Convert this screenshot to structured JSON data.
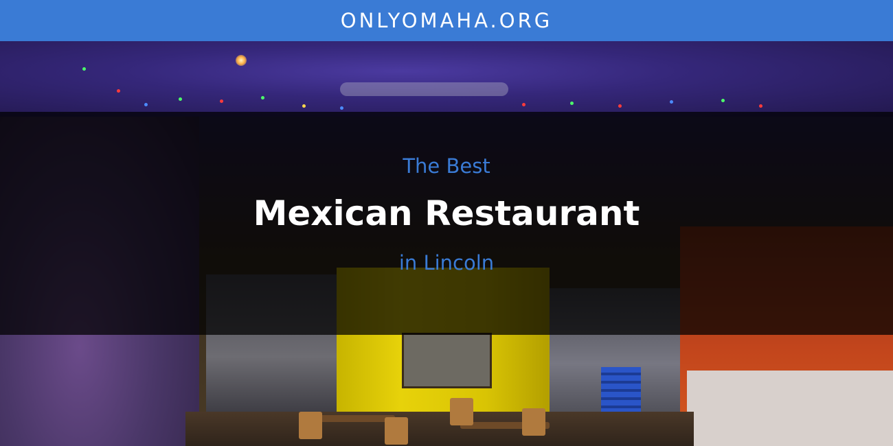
{
  "header": {
    "site_name": "ONLYOMAHA.ORG",
    "background_color": "#3a7bd5"
  },
  "headline": {
    "line1": "The Best",
    "line2": "Mexican Restaurant",
    "line3": "in Lincoln",
    "accent_color": "#3a7bd5",
    "main_color": "#ffffff"
  },
  "background_image": {
    "subject": "restaurant-interior-photo"
  }
}
